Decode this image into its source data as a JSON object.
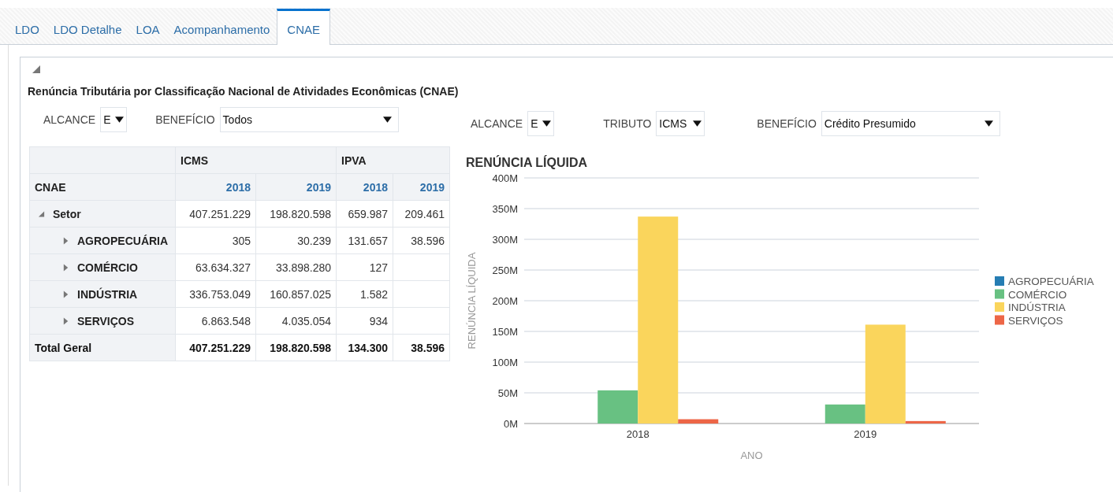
{
  "tabs": [
    {
      "label": "LDO",
      "selected": false
    },
    {
      "label": "LDO Detalhe",
      "selected": false
    },
    {
      "label": "LOA",
      "selected": false
    },
    {
      "label": "Acompanhamento",
      "selected": false
    },
    {
      "label": "CNAE",
      "selected": true
    }
  ],
  "panel": {
    "expanded": true,
    "title": "Renúncia Tributária por Classificação Nacional de Atividades Econômicas (CNAE)"
  },
  "left_filters": [
    {
      "label": "ALCANCE",
      "value": "E",
      "kind": "short"
    },
    {
      "label": "BENEFÍCIO",
      "value": "Todos",
      "kind": "wide"
    }
  ],
  "table": {
    "corner": "CNAE",
    "groups": [
      {
        "label": "ICMS",
        "years": [
          "2018",
          "2019"
        ]
      },
      {
        "label": "IPVA",
        "years": [
          "2018",
          "2019"
        ]
      }
    ],
    "rows": [
      {
        "label": "Setor",
        "kind": "group",
        "expanded": true,
        "values": [
          "407.251.229",
          "198.820.598",
          "659.987",
          "209.461"
        ]
      },
      {
        "label": "AGROPECUÁRIA",
        "kind": "item",
        "expanded": false,
        "values": [
          "305",
          "30.239",
          "131.657",
          "38.596"
        ]
      },
      {
        "label": "COMÉRCIO",
        "kind": "item",
        "expanded": false,
        "values": [
          "63.634.327",
          "33.898.280",
          "127"
        ]
      },
      {
        "label": "INDÚSTRIA",
        "kind": "item",
        "expanded": false,
        "values": [
          "336.753.049",
          "160.857.025",
          "1.582"
        ]
      },
      {
        "label": "SERVIÇOS",
        "kind": "item",
        "expanded": false,
        "values": [
          "6.863.548",
          "4.035.054",
          "934"
        ]
      },
      {
        "label": "Total Geral",
        "kind": "total",
        "values": [
          "407.251.229",
          "198.820.598",
          "134.300",
          "38.596"
        ]
      }
    ]
  },
  "right_filters": [
    {
      "label": "ALCANCE",
      "value": "E",
      "kind": "short"
    },
    {
      "label": "TRIBUTO",
      "value": "ICMS",
      "kind": "medium"
    },
    {
      "label": "BENEFÍCIO",
      "value": "Crédito Presumido",
      "kind": "wide"
    }
  ],
  "chart": {
    "chart_data": {
      "type": "bar",
      "title": "RENÚNCIA LÍQUIDA",
      "xlabel": "ANO",
      "ylabel": "RENÚNCIA LÍQUIDA",
      "categories": [
        "2018",
        "2019"
      ],
      "series": [
        {
          "name": "AGROPECUÁRIA",
          "color": "#267db3",
          "values": [
            0,
            0
          ]
        },
        {
          "name": "COMÉRCIO",
          "color": "#68c182",
          "values": [
            54,
            31
          ]
        },
        {
          "name": "INDÚSTRIA",
          "color": "#fad55c",
          "values": [
            337,
            161
          ]
        },
        {
          "name": "SERVIÇOS",
          "color": "#ed6647",
          "values": [
            7,
            4
          ]
        }
      ],
      "ylim": [
        0,
        400
      ],
      "grid": true,
      "legend": "right",
      "yticks": [
        {
          "value": 0,
          "label": "0M"
        },
        {
          "value": 50,
          "label": "50M"
        },
        {
          "value": 100,
          "label": "100M"
        },
        {
          "value": 150,
          "label": "150M"
        },
        {
          "value": 200,
          "label": "200M"
        },
        {
          "value": 250,
          "label": "250M"
        },
        {
          "value": 300,
          "label": "300M"
        },
        {
          "value": 350,
          "label": "350M"
        },
        {
          "value": 400,
          "label": "400M"
        }
      ]
    }
  }
}
